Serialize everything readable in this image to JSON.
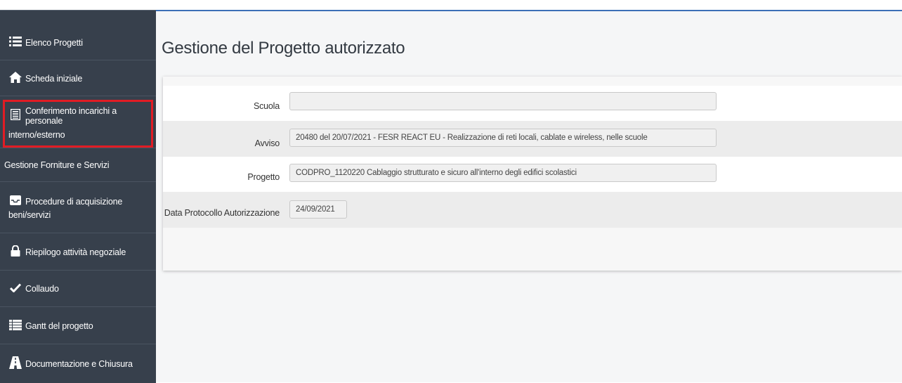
{
  "sidebar": {
    "items": [
      {
        "label": "Elenco Progetti",
        "icon": "list-icon"
      },
      {
        "label": "Scheda iniziale",
        "icon": "home-icon"
      },
      {
        "label_line1": "Conferimento incarichi a personale",
        "label_line2": "interno/esterno",
        "icon": "document-list-icon",
        "highlighted": true
      },
      {
        "label": "Gestione Forniture e Servizi"
      },
      {
        "label_line1": "Procedure di acquisizione",
        "label_line2": "beni/servizi",
        "icon": "inbox-icon"
      },
      {
        "label": "Riepilogo attività negoziale",
        "icon": "lock-icon"
      },
      {
        "label": "Collaudo",
        "icon": "check-icon"
      },
      {
        "label": "Gantt del progetto",
        "icon": "gantt-icon"
      },
      {
        "label": "Documentazione e Chiusura",
        "icon": "road-icon"
      }
    ]
  },
  "main": {
    "title": "Gestione del Progetto autorizzato",
    "form": {
      "scuola": {
        "label": "Scuola",
        "value": ""
      },
      "avviso": {
        "label": "Avviso",
        "value": "20480 del 20/07/2021 - FESR REACT EU - Realizzazione di reti locali, cablate e wireless, nelle scuole"
      },
      "progetto": {
        "label": "Progetto",
        "value": "CODPRO_1120220 Cablaggio strutturato e sicuro all'interno degli edifici scolastici"
      },
      "data_protocollo": {
        "label": "Data Protocollo Autorizzazione",
        "value": "24/09/2021"
      }
    }
  },
  "colors": {
    "sidebar_bg": "#37404c",
    "highlight": "#e11c24",
    "accent_line": "#3b6fb6"
  }
}
